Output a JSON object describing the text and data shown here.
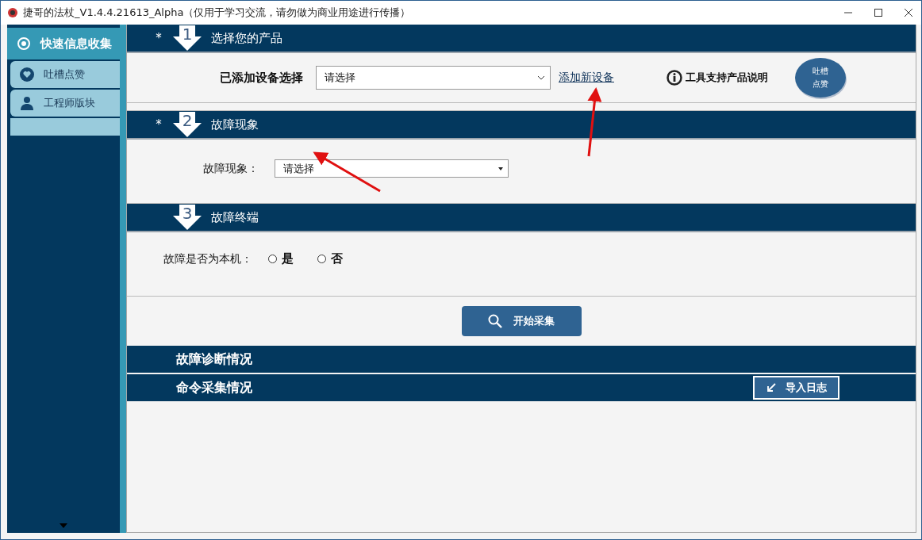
{
  "window": {
    "title": "捷哥的法杖_V1.4.4.21613_Alpha（仅用于学习交流，请勿做为商业用途进行传播）"
  },
  "sidebar": {
    "items": [
      {
        "label": "快速信息收集",
        "selected": true,
        "kind": "target"
      },
      {
        "label": "吐槽点赞",
        "selected": false,
        "kind": "heart"
      },
      {
        "label": "工程师版块",
        "selected": false,
        "kind": "engineer"
      }
    ]
  },
  "sections": [
    {
      "marker": "*",
      "step": "1",
      "title": "选择您的产品"
    },
    {
      "marker": "*",
      "step": "2",
      "title": "故障现象"
    },
    {
      "step": "3",
      "title": "故障终端"
    }
  ],
  "product": {
    "label": "已添加设备选择",
    "select_value": "请选择",
    "add_link": "添加新设备",
    "info_link": "工具支持产品说明",
    "round_button": [
      "吐槽",
      "点赞"
    ]
  },
  "fault": {
    "label": "故障现象：",
    "select_value": "请选择"
  },
  "terminal": {
    "label": "故障是否为本机：",
    "options": [
      {
        "label": "是",
        "selected": false
      },
      {
        "label": "否",
        "selected": false
      }
    ]
  },
  "start_button": "开始采集",
  "banners": [
    {
      "title": "故障诊断情况"
    },
    {
      "title": "命令采集情况",
      "button": "导入日志"
    }
  ]
}
